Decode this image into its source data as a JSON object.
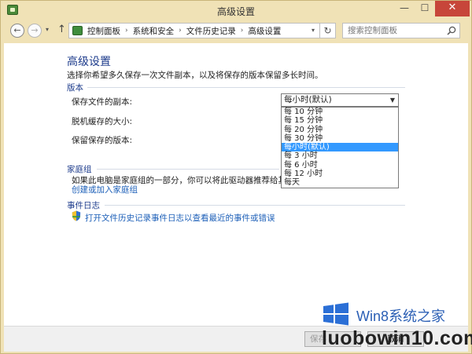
{
  "window": {
    "title": "高级设置",
    "min_glyph": "—",
    "max_glyph": "☐",
    "close_glyph": "✕"
  },
  "nav": {
    "back": "←",
    "forward": "→",
    "recent": "▾",
    "up": "↑",
    "refresh": "↻"
  },
  "breadcrumb": {
    "items": [
      "控制面板",
      "系统和安全",
      "文件历史记录",
      "高级设置"
    ],
    "separator": "›"
  },
  "search": {
    "placeholder": "搜索控制面板"
  },
  "page": {
    "title": "高级设置",
    "description": "选择你希望多久保存一次文件副本，以及将保存的版本保留多长时间。"
  },
  "versions": {
    "section_label": "版本",
    "save_copies_label": "保存文件的副本:",
    "offline_cache_label": "脱机缓存的大小:",
    "keep_versions_label": "保留保存的版本:",
    "save_copies_select": {
      "value": "每小时(默认)",
      "options": [
        "每 10 分钟",
        "每 15 分钟",
        "每 20 分钟",
        "每 30 分钟",
        "每小时(默认)",
        "每 3 小时",
        "每 6 小时",
        "每 12 小时",
        "每天"
      ],
      "selected_index": 4
    }
  },
  "homegroup": {
    "section_label": "家庭组",
    "text": "如果此电脑是家庭组的一部分，你可以将此驱动器推荐给其他家庭组",
    "link": "创建或加入家庭组"
  },
  "event_log": {
    "section_label": "事件日志",
    "link": "打开文件历史记录事件日志以查看最近的事件或错误"
  },
  "footer": {
    "save_button": "保存",
    "cancel_button": "取消"
  },
  "watermark": {
    "brand": "Win8系统之家",
    "url": "luobowin10.com"
  },
  "colors": {
    "accent": "#1e3c8c",
    "link": "#1c5fb8",
    "selection": "#3399ff",
    "window_frame": "#f0e2b6"
  }
}
